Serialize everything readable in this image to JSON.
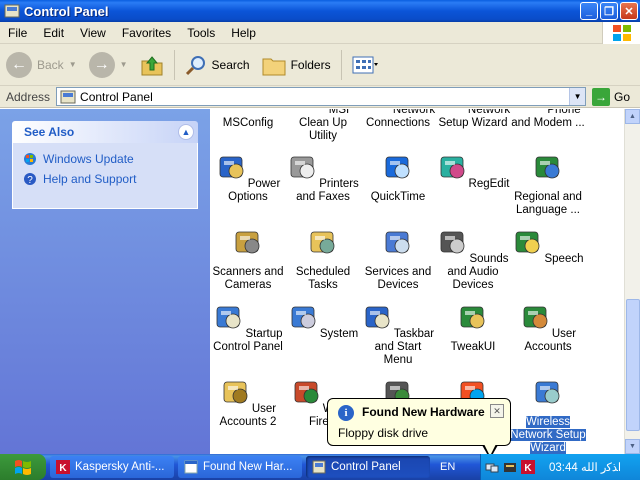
{
  "window": {
    "title": "Control Panel",
    "buttons": [
      "_",
      "❐",
      "✕"
    ]
  },
  "menu": [
    "File",
    "Edit",
    "View",
    "Favorites",
    "Tools",
    "Help"
  ],
  "toolbar": {
    "back": "Back",
    "search": "Search",
    "folders": "Folders"
  },
  "address": {
    "label": "Address",
    "value": "Control Panel",
    "go": "Go"
  },
  "see_also": {
    "title": "See Also",
    "links": [
      "Windows Update",
      "Help and Support"
    ]
  },
  "items": [
    {
      "label": "MSConfig",
      "icon": "msconfig-icon"
    },
    {
      "label": "MSI Clean Up Utility",
      "icon": "msi-cleanup-icon"
    },
    {
      "label": "Network Connections",
      "icon": "network-connections-icon"
    },
    {
      "label": "Network Setup Wizard",
      "icon": "network-setup-icon"
    },
    {
      "label": "Phone and Modem ...",
      "icon": "phone-modem-icon"
    },
    {
      "label": "Power Options",
      "icon": "power-options-icon"
    },
    {
      "label": "Printers and Faxes",
      "icon": "printers-icon"
    },
    {
      "label": "QuickTime",
      "icon": "quicktime-icon"
    },
    {
      "label": "RegEdit",
      "icon": "regedit-icon"
    },
    {
      "label": "Regional and Language ...",
      "icon": "regional-icon"
    },
    {
      "label": "Scanners and Cameras",
      "icon": "scanners-icon"
    },
    {
      "label": "Scheduled Tasks",
      "icon": "scheduled-tasks-icon"
    },
    {
      "label": "Services and Devices",
      "icon": "services-icon"
    },
    {
      "label": "Sounds and Audio Devices",
      "icon": "sounds-icon"
    },
    {
      "label": "Speech",
      "icon": "speech-icon"
    },
    {
      "label": "Startup Control Panel",
      "icon": "startup-icon"
    },
    {
      "label": "System",
      "icon": "system-icon"
    },
    {
      "label": "Taskbar and Start Menu",
      "icon": "taskbar-icon"
    },
    {
      "label": "TweakUI",
      "icon": "tweakui-icon"
    },
    {
      "label": "User Accounts",
      "icon": "user-accounts-icon"
    },
    {
      "label": "User Accounts 2",
      "icon": "user-accounts-2-icon"
    },
    {
      "label": "Windo Firew",
      "icon": "windows-firewall-icon"
    },
    {
      "label": "",
      "icon": "partial-icon"
    },
    {
      "label": "",
      "icon": "windows-flag-icon"
    },
    {
      "label": "Wireless Network Setup Wizard",
      "icon": "wireless-icon",
      "selected": true
    }
  ],
  "balloon": {
    "title": "Found New Hardware",
    "text": "Floppy disk drive",
    "close": "✕"
  },
  "taskbar": {
    "tasks": [
      "Kaspersky Anti-...",
      "Found New Har...",
      "Control Panel"
    ],
    "lang": "EN",
    "clock": "03:44 ﺍﺬﻛﺭ ﺍﻟﻠﻪ"
  }
}
